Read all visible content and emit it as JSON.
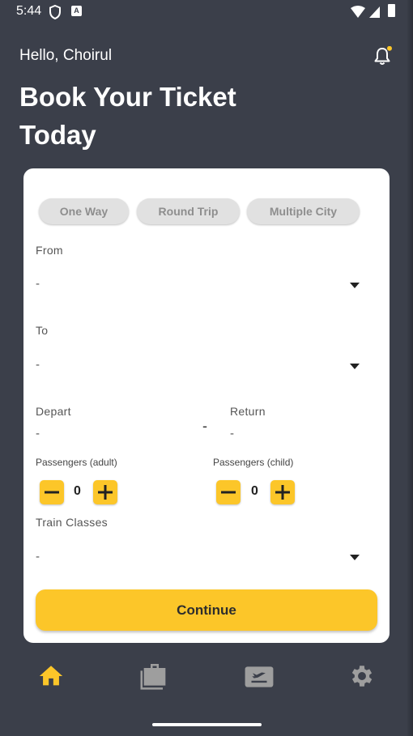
{
  "status_bar": {
    "time": "5:44",
    "notification_badge_text": "A"
  },
  "header": {
    "greeting": "Hello, Choirul",
    "title": "Book Your Ticket Today"
  },
  "trip_types": [
    {
      "label": "One Way"
    },
    {
      "label": "Round Trip"
    },
    {
      "label": "Multiple City"
    }
  ],
  "form": {
    "from": {
      "label": "From",
      "value": "-"
    },
    "to": {
      "label": "To",
      "value": "-"
    },
    "depart": {
      "label": "Depart",
      "value": "-"
    },
    "range_separator": "-",
    "return": {
      "label": "Return",
      "value": "-"
    },
    "passengers_adult": {
      "label": "Passengers (adult)",
      "count": "0"
    },
    "passengers_child": {
      "label": "Passengers (child)",
      "count": "0"
    },
    "train_classes": {
      "label": "Train Classes",
      "value": "-"
    },
    "continue_label": "Continue"
  },
  "bottom_nav": [
    {
      "icon": "home-icon",
      "active": true
    },
    {
      "icon": "luggage-icon",
      "active": false
    },
    {
      "icon": "ticket-flight-icon",
      "active": false
    },
    {
      "icon": "settings-gear-icon",
      "active": false
    }
  ],
  "colors": {
    "background": "#3b3f4a",
    "accent": "#fcc629",
    "card": "#ffffff",
    "chip": "#e1e1e1",
    "inactive_nav": "#9e9e9e",
    "notification_dot": "#fcc629"
  }
}
